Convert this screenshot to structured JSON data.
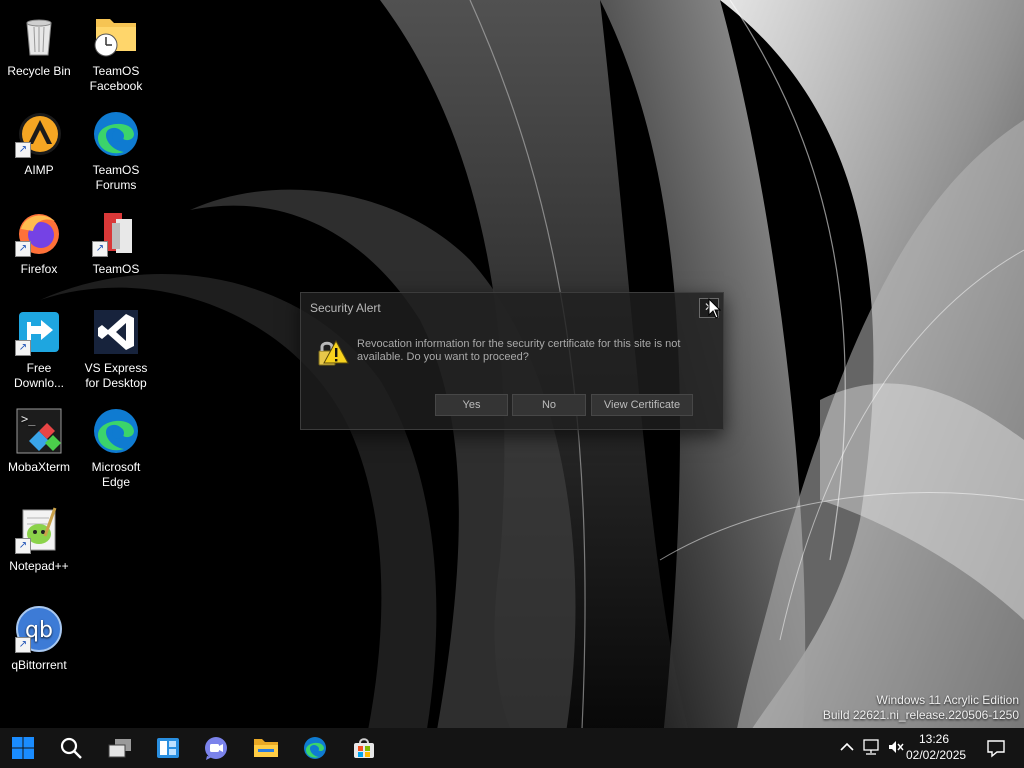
{
  "desktop_icons": [
    {
      "label": "Recycle Bin",
      "icon": "recycle-bin-icon"
    },
    {
      "label": "TeamOS Facebook",
      "icon": "folder-clock-icon"
    },
    {
      "label": "AIMP",
      "icon": "aimp-icon"
    },
    {
      "label": "TeamOS Forums",
      "icon": "edge-icon"
    },
    {
      "label": "Firefox",
      "icon": "firefox-icon"
    },
    {
      "label": "TeamOS",
      "icon": "teamos-icon"
    },
    {
      "label": "Free Downlo...",
      "icon": "free-download-manager-icon"
    },
    {
      "label": "VS Express for Desktop",
      "icon": "visual-studio-icon"
    },
    {
      "label": "MobaXterm",
      "icon": "mobaxterm-icon"
    },
    {
      "label": "Microsoft Edge",
      "icon": "edge-icon"
    },
    {
      "label": "Notepad++",
      "icon": "notepadpp-icon"
    },
    {
      "label": "qBittorrent",
      "icon": "qbittorrent-icon"
    }
  ],
  "dialog": {
    "title": "Security Alert",
    "close_glyph": "✕",
    "message": "Revocation information for the security certificate for this site is not available. Do you want to proceed?",
    "buttons": {
      "yes": "Yes",
      "no": "No",
      "view_certificate": "View Certificate"
    },
    "icon": "warning-lock-icon"
  },
  "watermark": {
    "line1": "Windows 11 Acrylic Edition",
    "line2": "Build 22621.ni_release.220506-1250"
  },
  "taskbar": {
    "items": [
      "start-icon",
      "search-icon",
      "task-view-icon",
      "widgets-icon",
      "chat-icon",
      "file-explorer-icon",
      "edge-icon",
      "store-icon"
    ],
    "tray": {
      "time": "13:26",
      "date": "02/02/2025"
    }
  },
  "colors": {
    "taskbar": "#141414",
    "dialog_bg": "#1e1e1e",
    "accent": "#1a8cff"
  }
}
